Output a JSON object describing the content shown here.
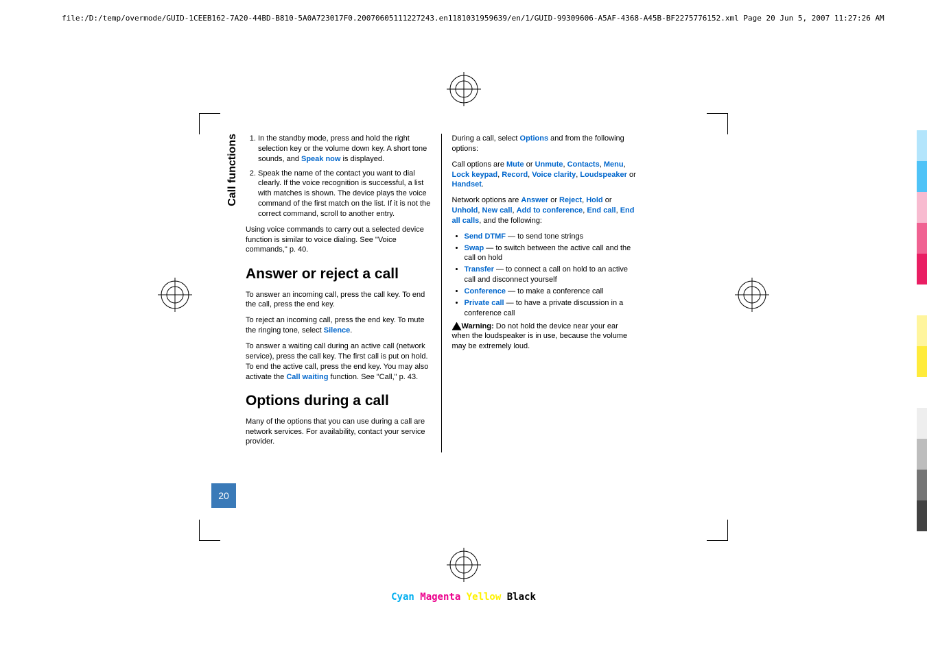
{
  "header": "file:/D:/temp/overmode/GUID-1CEEB162-7A20-44BD-B810-5A0A723017F0.20070605111227243.en1181031959639/en/1/GUID-99309606-A5AF-4368-A45B-BF2275776152.xml    Page 20    Jun 5, 2007 11:27:26 AM",
  "sidelabel": "Call functions",
  "pagenum": "20",
  "col1": {
    "step1": "In the standby mode, press and hold the right selection key or the volume down key. A short tone sounds, and ",
    "step1b": "Speak now",
    "step1c": " is displayed.",
    "step2": "Speak the name of the contact you want to dial clearly. If the voice recognition is successful, a list with matches is shown. The device plays the voice command of the first match on the list. If it is not the correct command, scroll to another entry.",
    "p1": "Using voice commands to carry out a selected device function is similar to voice dialing. See \"Voice commands,\" p. 40.",
    "h1": "Answer or reject a call",
    "p2": "To answer an incoming call, press the call key. To end the call, press the end key.",
    "p3a": "To reject an incoming call, press the end key. To mute the ringing tone, select ",
    "p3b": "Silence",
    "p3c": ".",
    "p4a": "To answer a waiting call during an active call (network service), press the call key. The first call is put on hold. To end the active call, press the end key. You may also activate the ",
    "p4b": "Call waiting",
    "p4c": " function. See \"Call,\" p. 43.",
    "h2": "Options during a call",
    "p5": "Many of the options that you can use during a call are network services. For availability, contact your service provider."
  },
  "col2": {
    "p1a": "During a call, select ",
    "p1b": "Options",
    "p1c": " and from the following options:",
    "p2a": "Call options are ",
    "mute": "Mute",
    "or": " or ",
    "unmute": "Unmute",
    "c": ", ",
    "contacts": "Contacts",
    "menu": "Menu",
    "lock": "Lock keypad",
    "record": "Record",
    "clarity": "Voice clarity",
    "loud": "Loudspeaker",
    "handset": "Handset",
    "dot": ".",
    "p3a": "Network options are ",
    "answer": "Answer",
    "reject": "Reject",
    "hold": "Hold",
    "unhold": "Unhold",
    "newcall": "New call",
    "addconf": "Add to conference",
    "endcall": "End call",
    "endall": "End all calls",
    "p3b": ", and the following:",
    "li1a": "Send DTMF",
    "li1b": " —  to send tone strings",
    "li2a": "Swap",
    "li2b": " —  to switch between the active call and the call on hold",
    "li3a": "Transfer",
    "li3b": " —  to connect a call on hold to an active call and disconnect yourself",
    "li4a": "Conference",
    "li4b": " —  to make a conference call",
    "li5a": "Private call",
    "li5b": " — to have a private discussion in a conference call",
    "warn": "Warning:",
    "warnb": "  Do not hold the device near your ear when the loudspeaker is in use, because the volume may be extremely loud."
  },
  "colors": {
    "c1": "Cyan",
    "c2": "Magenta",
    "c3": "Yellow",
    "c4": "Black"
  }
}
